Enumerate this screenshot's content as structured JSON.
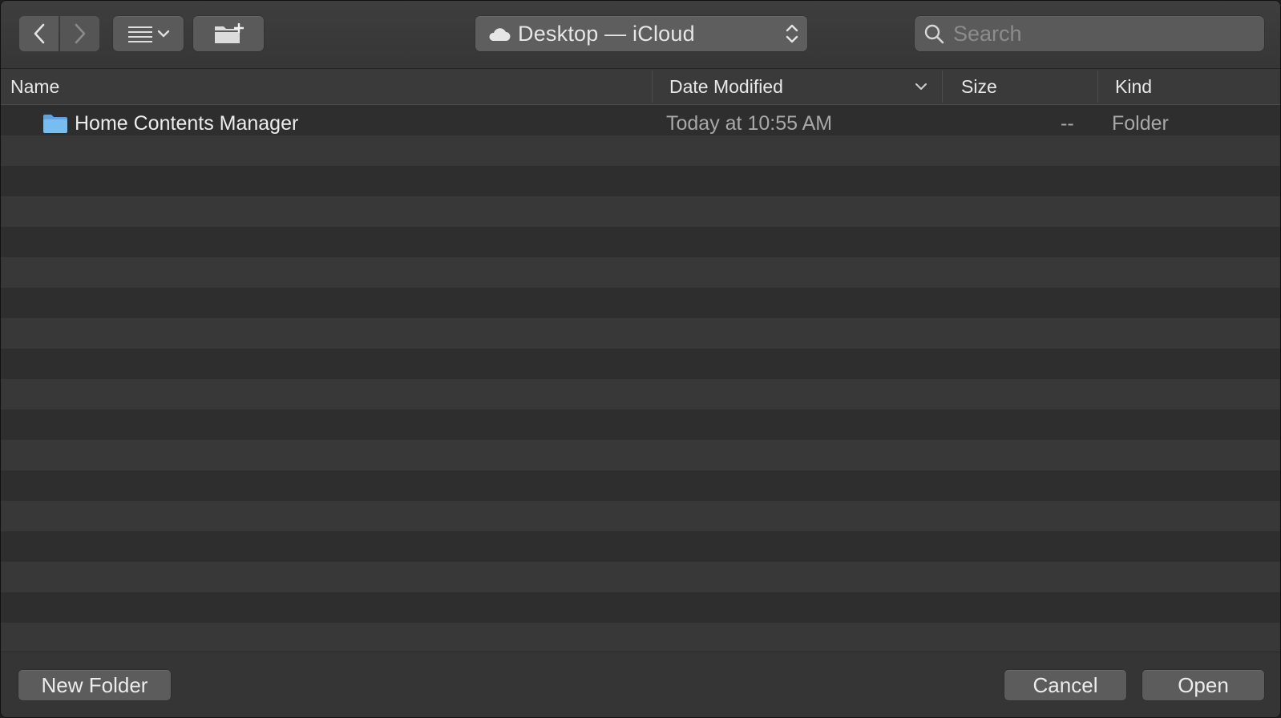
{
  "toolbar": {
    "location": "Desktop — iCloud",
    "search_placeholder": "Search",
    "view_mode": "list",
    "icons": {
      "back": "chevron-left-icon",
      "forward": "chevron-right-icon",
      "view": "list-view-icon",
      "new_folder": "folder-plus-icon",
      "location": "cloud-icon",
      "search": "search-icon"
    }
  },
  "columns": {
    "name": "Name",
    "date_modified": "Date Modified",
    "size": "Size",
    "kind": "Kind",
    "sorted_by": "Date Modified"
  },
  "files": [
    {
      "name": "Home Contents Manager",
      "date_modified": "Today at 10:55 AM",
      "size": "--",
      "kind": "Folder",
      "icon": "folder-icon"
    }
  ],
  "footer": {
    "new_folder_label": "New Folder",
    "cancel_label": "Cancel",
    "open_label": "Open"
  },
  "colors": {
    "folder": "#6fb3e8",
    "window_bg": "#323232",
    "row_alt": "#383838"
  }
}
